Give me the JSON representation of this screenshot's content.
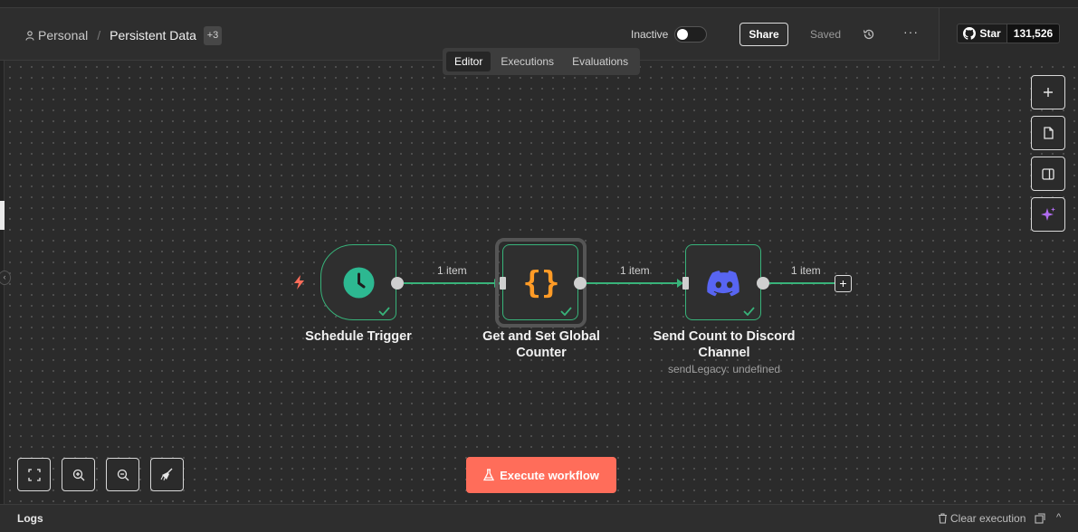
{
  "header": {
    "project": "Personal",
    "workflow_title": "Persistent Data",
    "tag_count": "+3",
    "status_label": "Inactive",
    "share_label": "Share",
    "saved_label": "Saved",
    "more_label": "···",
    "github": {
      "star_label": "Star",
      "star_count": "131,526"
    }
  },
  "tabs": [
    {
      "label": "Editor",
      "active": true
    },
    {
      "label": "Executions",
      "active": false
    },
    {
      "label": "Evaluations",
      "active": false
    }
  ],
  "nodes": {
    "schedule": {
      "label": "Schedule Trigger",
      "icon": "clock-icon"
    },
    "code": {
      "label_line1": "Get and Set Global",
      "label_line2": "Counter",
      "icon_text": "{}"
    },
    "discord": {
      "label_line1": "Send Count to Discord",
      "label_line2": "Channel",
      "subtitle": "sendLegacy: undefined"
    }
  },
  "edges": {
    "e1": "1 item",
    "e2": "1 item",
    "e3": "1 item"
  },
  "canvas_controls": {
    "execute_label": "Execute workflow",
    "plus": "+"
  },
  "logs": {
    "label": "Logs",
    "clear_label": "Clear execution",
    "collapse": "^"
  },
  "colors": {
    "accent": "#ff6d5a",
    "success": "#38b37a",
    "clock": "#2db891",
    "code": "#ff9b26",
    "discord": "#5865f2",
    "ai": "#b06cf0"
  }
}
